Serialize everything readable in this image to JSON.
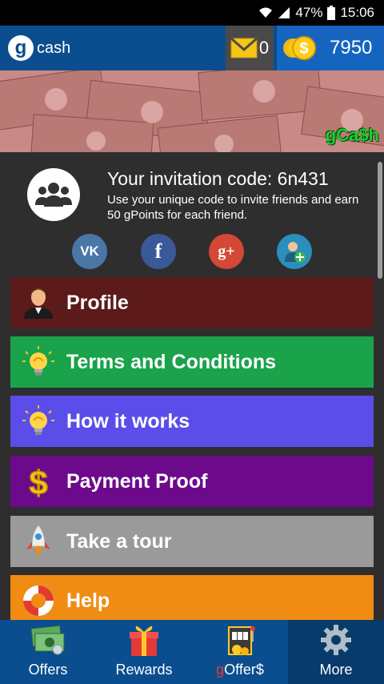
{
  "status_bar": {
    "battery": "47%",
    "time": "15:06"
  },
  "app_bar": {
    "logo_letter": "g",
    "logo_text": "cash",
    "messages_count": "0",
    "coins": "7950"
  },
  "banner": {
    "tag_text": "gCa$h"
  },
  "invitation": {
    "title": "Your invitation code: 6n431",
    "subtitle": "Use your unique code to invite friends and earn 50 gPoints for each friend.",
    "social": [
      {
        "label": "VK",
        "color": "#4a76a8",
        "icon": "vk-icon"
      },
      {
        "label": "f",
        "color": "#3b5998",
        "icon": "facebook-icon"
      },
      {
        "label": "g+",
        "color": "#d34836",
        "icon": "google-plus-icon"
      },
      {
        "label": "+",
        "color": "#2a8fbd",
        "icon": "add-contact-icon"
      }
    ]
  },
  "menu": [
    {
      "label": "Profile",
      "color": "#5c1a1a",
      "icon": "person-icon"
    },
    {
      "label": "Terms and Conditions",
      "color": "#1aa34a",
      "icon": "lightbulb-icon"
    },
    {
      "label": "How it works",
      "color": "#5b4dea",
      "icon": "lightbulb-icon"
    },
    {
      "label": "Payment Proof",
      "color": "#6d0a8c",
      "icon": "dollar-icon"
    },
    {
      "label": "Take a tour",
      "color": "#9a9a9a",
      "icon": "rocket-icon"
    },
    {
      "label": "Help",
      "color": "#f08c14",
      "icon": "lifebuoy-icon"
    }
  ],
  "bottom_nav": [
    {
      "label": "Offers",
      "icon": "money-icon",
      "active": false
    },
    {
      "label": "Rewards",
      "icon": "gift-icon",
      "active": false
    },
    {
      "label_prefix": "g",
      "label": "Offer$",
      "icon": "slot-machine-icon",
      "active": false
    },
    {
      "label": "More",
      "icon": "gear-icon",
      "active": true
    }
  ]
}
